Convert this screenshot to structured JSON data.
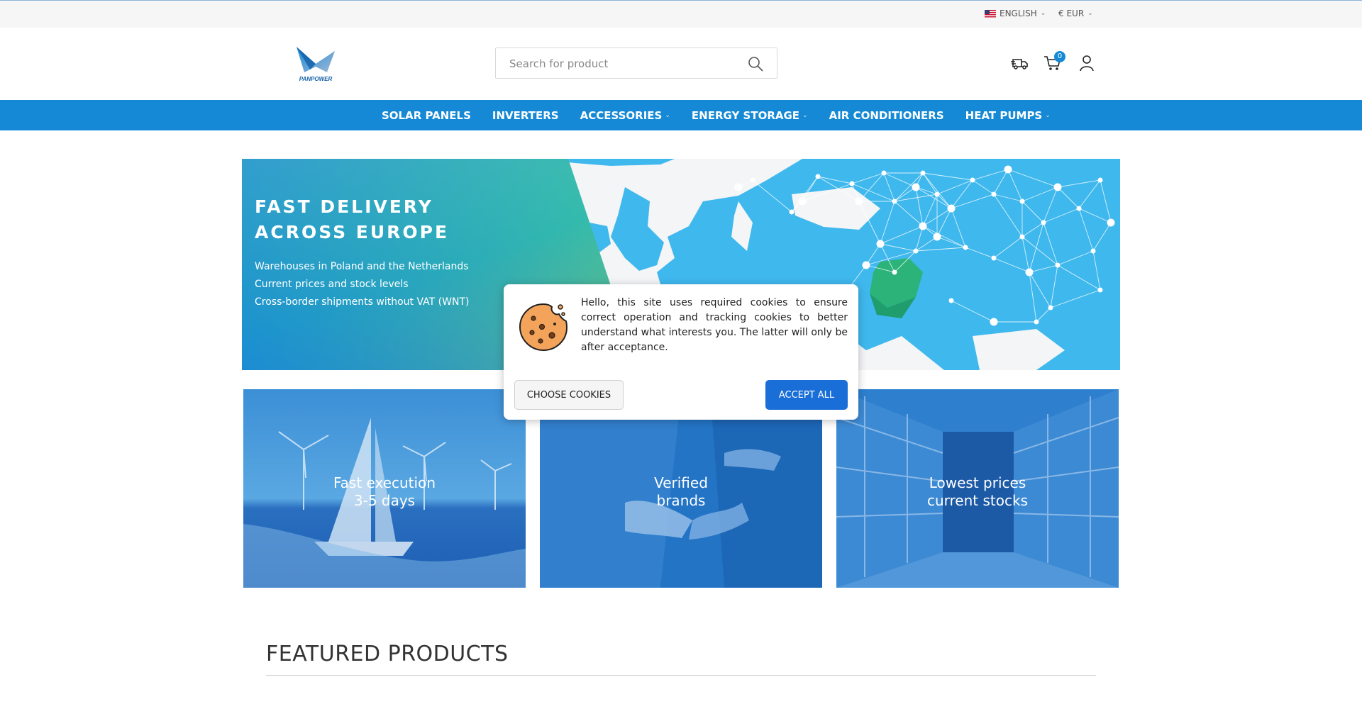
{
  "topbar": {
    "language": "ENGLISH",
    "currency": "€ EUR"
  },
  "header": {
    "logo_text": "PANPOWER",
    "search_placeholder": "Search for product",
    "cart_count": "0"
  },
  "nav": {
    "items": [
      {
        "label": "SOLAR PANELS",
        "dropdown": false
      },
      {
        "label": "INVERTERS",
        "dropdown": false
      },
      {
        "label": "ACCESSORIES",
        "dropdown": true
      },
      {
        "label": "ENERGY STORAGE",
        "dropdown": true
      },
      {
        "label": "AIR CONDITIONERS",
        "dropdown": false
      },
      {
        "label": "HEAT PUMPS",
        "dropdown": true
      }
    ]
  },
  "hero": {
    "title_line1": "FAST DELIVERY",
    "title_line2": "ACROSS EUROPE",
    "lines": [
      "Warehouses in Poland and the Netherlands",
      "Current prices and stock levels",
      "Cross-border shipments without VAT (WNT)"
    ]
  },
  "tiles": [
    {
      "line1": "Fast execution",
      "line2": "3-5 days"
    },
    {
      "line1": "Verified",
      "line2": "brands"
    },
    {
      "line1": "Lowest prices",
      "line2": "current stocks"
    }
  ],
  "cookie": {
    "message": "Hello, this site uses required cookies to ensure correct operation and tracking cookies to better understand what interests you. The latter will only be after acceptance.",
    "choose_label": "CHOOSE COOKIES",
    "accept_label": "ACCEPT ALL"
  },
  "featured": {
    "title": "FEATURED PRODUCTS"
  },
  "colors": {
    "brand_blue": "#1589d6",
    "accept_blue": "#1a6ed8",
    "map_blue": "#3fb8ee"
  }
}
